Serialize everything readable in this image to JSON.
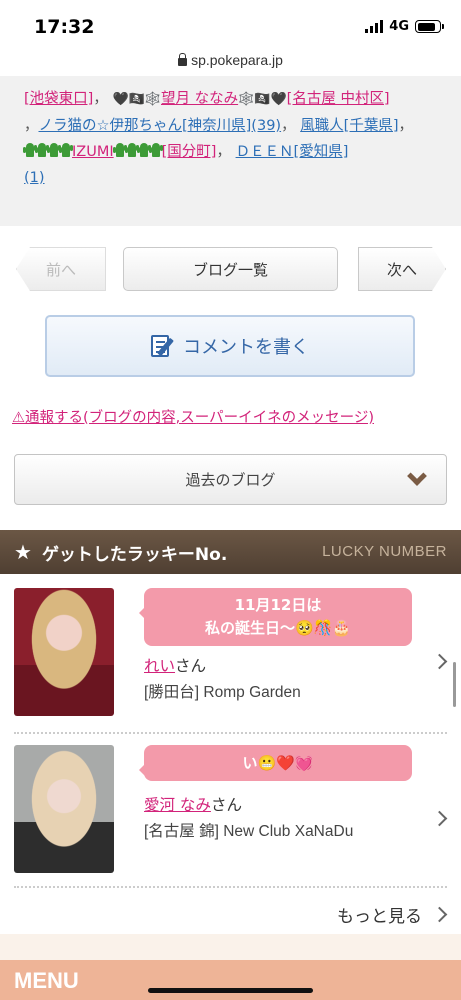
{
  "status": {
    "time": "17:32",
    "network": "4G"
  },
  "browser": {
    "host": "sp.pokepara.jp"
  },
  "likes": {
    "line1_a": "[池袋東口]",
    "line1_b": "望月 ななみ",
    "line1_c": "[名古屋 中村区]",
    "line2_a": "ノラ猫の☆伊那ちゃん[神奈川県](39)",
    "line2_b": "風職人[千葉県]",
    "line3_a": "IZUMI",
    "line3_b": "[国分町]",
    "line3_c": "ＤＥＥＮ[愛知県]",
    "line4": "(1)",
    "sep": "，"
  },
  "nav": {
    "prev_label": "前へ",
    "list_label": "ブログ一覧",
    "next_label": "次へ",
    "comment_label": "コメントを書く",
    "report_label": "⚠通報する(ブログの内容,スーパーイイネのメッセージ)",
    "past_label": "過去のブログ"
  },
  "lucky": {
    "title": "ゲットしたラッキーNo.",
    "title_en": "LUCKY NUMBER",
    "entries": [
      {
        "bubble_line1": "11月12日は",
        "bubble_line2": "私の誕生日～🥺🎊🎂",
        "name": "れい",
        "suffix": "さん",
        "shop": "[勝田台] Romp Garden"
      },
      {
        "bubble_line1": "い😬❤️💓",
        "name": "愛河 なみ",
        "suffix": "さん",
        "shop": "[名古屋 錦] New Club XaNaDu"
      }
    ],
    "more_label": "もっと見る"
  },
  "menu": {
    "label": "MENU"
  }
}
